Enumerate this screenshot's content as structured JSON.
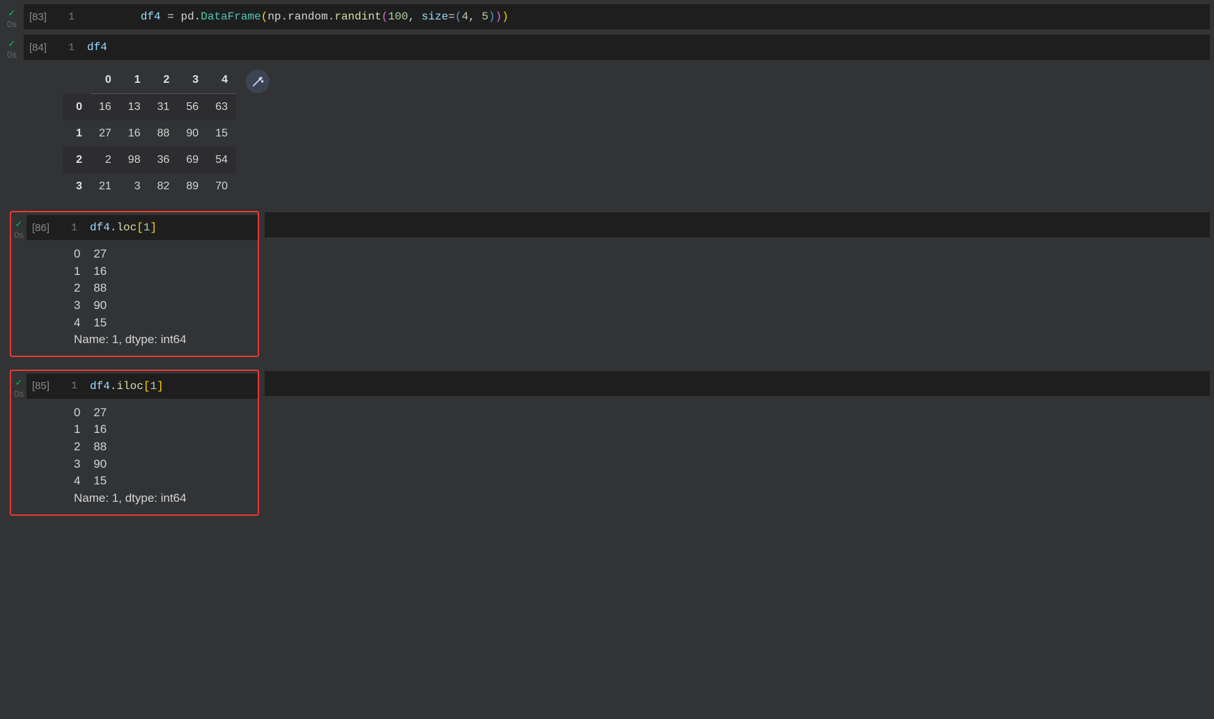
{
  "exec_time": "0s",
  "cells": [
    {
      "id": "c83",
      "exec_count": "[83]",
      "line_no": "1",
      "tokens": {
        "var": "df4",
        "eq": " = ",
        "pd": "pd",
        "DataFrame": "DataFrame",
        "np": "np",
        "random": "random",
        "randint": "randint",
        "hundred": "100",
        "comma_sp": ", ",
        "size_kw": "size",
        "four": "4",
        "five": "5"
      }
    },
    {
      "id": "c84",
      "exec_count": "[84]",
      "line_no": "1",
      "code_text": "df4"
    },
    {
      "id": "c86",
      "exec_count": "[86]",
      "line_no": "1",
      "tokens": {
        "var": "df4",
        "loc": "loc",
        "one": "1"
      }
    },
    {
      "id": "c85",
      "exec_count": "[85]",
      "line_no": "1",
      "tokens": {
        "var": "df4",
        "iloc": "iloc",
        "one": "1"
      }
    }
  ],
  "df4": {
    "columns": [
      "0",
      "1",
      "2",
      "3",
      "4"
    ],
    "index": [
      "0",
      "1",
      "2",
      "3"
    ],
    "data": [
      [
        "16",
        "13",
        "31",
        "56",
        "63"
      ],
      [
        "27",
        "16",
        "88",
        "90",
        "15"
      ],
      [
        "2",
        "98",
        "36",
        "69",
        "54"
      ],
      [
        "21",
        "3",
        "82",
        "89",
        "70"
      ]
    ]
  },
  "series_out": {
    "lines": [
      "0    27",
      "1    16",
      "2    88",
      "3    90",
      "4    15"
    ],
    "footer": "Name: 1, dtype: int64"
  }
}
